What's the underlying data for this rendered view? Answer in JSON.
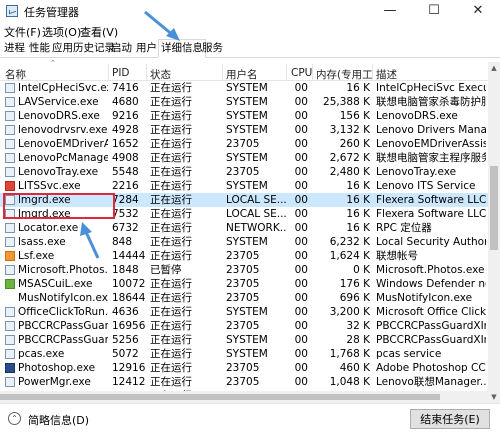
{
  "window": {
    "title": "任务管理器"
  },
  "menu": [
    "文件(F)",
    "选项(O)",
    "查看(V)"
  ],
  "tabs": [
    "进程",
    "性能",
    "应用历史记录",
    "启动",
    "用户",
    "详细信息",
    "服务"
  ],
  "active_tab": "详细信息",
  "columns": [
    "名称",
    "PID",
    "状态",
    "用户名",
    "CPU",
    "内存(专用工…",
    "描述"
  ],
  "rows": [
    {
      "name": "IntelCpHeciSvc.exe",
      "pid": "7416",
      "status": "正在运行",
      "user": "SYSTEM",
      "cpu": "00",
      "mem": "16 K",
      "desc": "IntelCpHeciSvc Executa...",
      "icon": "generic"
    },
    {
      "name": "LAVService.exe",
      "pid": "4680",
      "status": "正在运行",
      "user": "SYSTEM",
      "cpu": "00",
      "mem": "25,388 K",
      "desc": "联想电脑管家杀毒防护服...",
      "icon": "generic"
    },
    {
      "name": "LenovoDRS.exe",
      "pid": "9216",
      "status": "正在运行",
      "user": "SYSTEM",
      "cpu": "00",
      "mem": "156 K",
      "desc": "LenovoDRS.exe",
      "icon": "generic"
    },
    {
      "name": "lenovodrvsrv.exe",
      "pid": "4928",
      "status": "正在运行",
      "user": "SYSTEM",
      "cpu": "00",
      "mem": "3,132 K",
      "desc": "Lenovo Drivers Manage...",
      "icon": "generic"
    },
    {
      "name": "LenovoEMDriverAssist...",
      "pid": "1652",
      "status": "正在运行",
      "user": "23705",
      "cpu": "00",
      "mem": "260 K",
      "desc": "LenovoEMDriverAssist",
      "icon": "generic"
    },
    {
      "name": "LenovoPcManagerS...",
      "pid": "4908",
      "status": "正在运行",
      "user": "SYSTEM",
      "cpu": "00",
      "mem": "2,672 K",
      "desc": "联想电脑管家主程序服务",
      "icon": "generic"
    },
    {
      "name": "LenovoTray.exe",
      "pid": "5548",
      "status": "正在运行",
      "user": "23705",
      "cpu": "00",
      "mem": "2,480 K",
      "desc": "LenovoTray.exe",
      "icon": "generic"
    },
    {
      "name": "LITSSvc.exe",
      "pid": "2216",
      "status": "正在运行",
      "user": "SYSTEM",
      "cpu": "00",
      "mem": "16 K",
      "desc": "Lenovo ITS Service",
      "icon": "red"
    },
    {
      "name": "lmgrd.exe",
      "pid": "7284",
      "status": "正在运行",
      "user": "LOCAL SE...",
      "cpu": "00",
      "mem": "16 K",
      "desc": "Flexera Software LLC",
      "icon": "generic",
      "selected": true
    },
    {
      "name": "lmgrd.exe",
      "pid": "7532",
      "status": "正在运行",
      "user": "LOCAL SE...",
      "cpu": "00",
      "mem": "16 K",
      "desc": "Flexera Software LLC",
      "icon": "generic"
    },
    {
      "name": "Locator.exe",
      "pid": "6732",
      "status": "正在运行",
      "user": "NETWORK...",
      "cpu": "00",
      "mem": "16 K",
      "desc": "RPC 定位器",
      "icon": "generic"
    },
    {
      "name": "lsass.exe",
      "pid": "848",
      "status": "正在运行",
      "user": "SYSTEM",
      "cpu": "00",
      "mem": "6,232 K",
      "desc": "Local Security Authorit...",
      "icon": "generic"
    },
    {
      "name": "Lsf.exe",
      "pid": "14444",
      "status": "正在运行",
      "user": "23705",
      "cpu": "00",
      "mem": "1,624 K",
      "desc": "联想帐号",
      "icon": "orange"
    },
    {
      "name": "Microsoft.Photos.exe",
      "pid": "1848",
      "status": "已暂停",
      "user": "23705",
      "cpu": "00",
      "mem": "0 K",
      "desc": "Microsoft.Photos.exe",
      "icon": "generic"
    },
    {
      "name": "MSASCuiL.exe",
      "pid": "10072",
      "status": "正在运行",
      "user": "23705",
      "cpu": "00",
      "mem": "176 K",
      "desc": "Windows Defender not...",
      "icon": "green"
    },
    {
      "name": "MusNotifyIcon.exe",
      "pid": "18644",
      "status": "正在运行",
      "user": "23705",
      "cpu": "00",
      "mem": "696 K",
      "desc": "MusNotifyIcon.exe",
      "icon": "none"
    },
    {
      "name": "OfficeClickToRun.exe",
      "pid": "4636",
      "status": "正在运行",
      "user": "SYSTEM",
      "cpu": "00",
      "mem": "3,200 K",
      "desc": "Microsoft Office Click-t...",
      "icon": "generic"
    },
    {
      "name": "PBCCRCPassGuard...",
      "pid": "16956",
      "status": "正在运行",
      "user": "23705",
      "cpu": "00",
      "mem": "32 K",
      "desc": "PBCCRCPassGuardXInp...",
      "icon": "generic"
    },
    {
      "name": "PBCCRCPassGuard...",
      "pid": "5256",
      "status": "正在运行",
      "user": "SYSTEM",
      "cpu": "00",
      "mem": "28 K",
      "desc": "PBCCRCPassGuardXInp...",
      "icon": "generic"
    },
    {
      "name": "pcas.exe",
      "pid": "5072",
      "status": "正在运行",
      "user": "SYSTEM",
      "cpu": "00",
      "mem": "1,768 K",
      "desc": "pcas service",
      "icon": "generic"
    },
    {
      "name": "Photoshop.exe",
      "pid": "12916",
      "status": "正在运行",
      "user": "23705",
      "cpu": "00",
      "mem": "460 K",
      "desc": "Adobe Photoshop CC 2...",
      "icon": "photo"
    },
    {
      "name": "PowerMgr.exe",
      "pid": "12412",
      "status": "正在运行",
      "user": "23705",
      "cpu": "00",
      "mem": "1,048 K",
      "desc": "Lenovo联想Manager...",
      "icon": "generic"
    },
    {
      "name": "PPDCInput.exe",
      "pid": "8256",
      "status": "正在运行",
      "user": "23705",
      "cpu": "00",
      "mem": "1,452 K",
      "desc": "PPDCInput.exe",
      "icon": "generic"
    }
  ],
  "footer": {
    "toggle_label": "简略信息(D)",
    "end_task_label": "结束任务(E)"
  },
  "colors": {
    "selection": "#cce8ff",
    "annotation": "#e0283c",
    "arrow": "#4a90d9"
  },
  "icons": [
    "app-icon",
    "minimize-icon",
    "maximize-icon",
    "close-icon",
    "sort-up-icon",
    "collapse-icon"
  ]
}
